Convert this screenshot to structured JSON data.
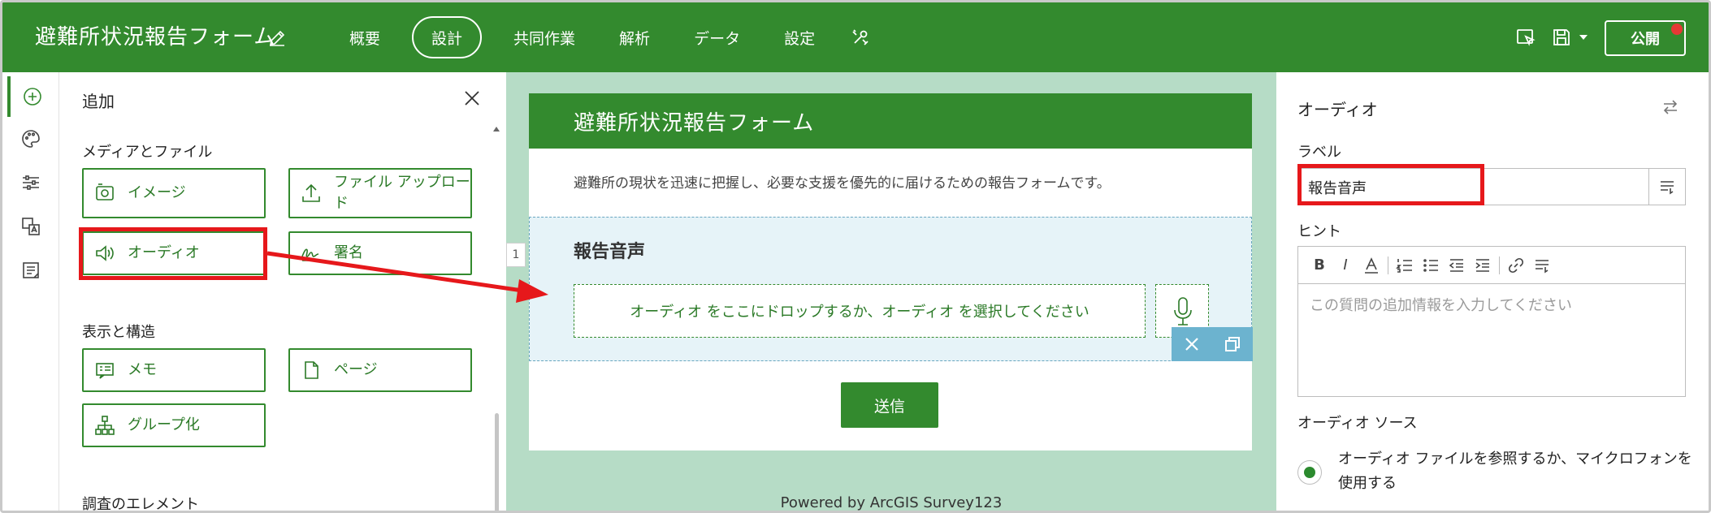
{
  "topbar": {
    "title": "避難所状況報告フォーム",
    "tabs": [
      "概要",
      "設計",
      "共同作業",
      "解析",
      "データ",
      "設定"
    ],
    "active_tab": "設計",
    "publish_label": "公開"
  },
  "add_panel": {
    "title": "追加",
    "sections": [
      {
        "label": "メディアとファイル"
      },
      {
        "label": "表示と構造"
      },
      {
        "label": "調査のエレメント"
      }
    ],
    "tiles": {
      "image": "イメージ",
      "file_upload": "ファイル アップロード",
      "audio": "オーディオ",
      "signature": "署名",
      "note": "メモ",
      "page": "ページ",
      "group": "グループ化"
    }
  },
  "form": {
    "header": "避難所状況報告フォーム",
    "description": "避難所の現状を迅速に把握し、必要な支援を優先的に届けるための報告フォームです。",
    "question_number": "1",
    "question_label": "報告音声",
    "dropzone_text": "オーディオ をここにドロップするか、オーディオ を選択してください",
    "submit_label": "送信",
    "powered_by": "Powered by ArcGIS Survey123"
  },
  "properties": {
    "title": "オーディオ",
    "label_field": "ラベル",
    "label_value": "報告音声",
    "hint_field": "ヒント",
    "hint_placeholder": "この質問の追加情報を入力してください",
    "audio_source_field": "オーディオ ソース",
    "audio_source_option": "オーディオ ファイルを参照するか、マイクロフォンを使用する"
  },
  "colors": {
    "brand_green": "#338a2e",
    "canvas_bg": "#b6dcc6",
    "highlight_red": "#e6181b",
    "question_bg": "#e6f3f8"
  }
}
